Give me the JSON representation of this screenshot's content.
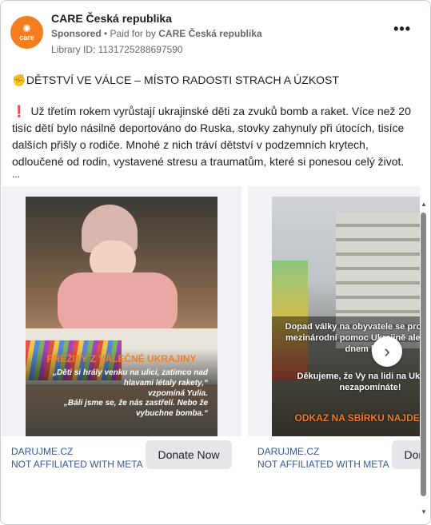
{
  "ad": {
    "page_name": "CARE Česká republika",
    "sponsored": "Sponsored",
    "paid_for_prefix": "• Paid for by",
    "paid_for_by": "CARE Česká republika",
    "library_id": "Library ID: 1131725288697590",
    "logo_text": "care",
    "more_menu": "•••"
  },
  "post": {
    "headline_emoji": "✊",
    "headline": "DĚTSTVÍ VE VÁLCE – MÍSTO RADOSTI STRACH A ÚZKOST",
    "body_mark": "❗",
    "body": "Už třetím rokem vyrůstají ukrajinské děti za zvuků bomb a raket. Více než 20 tisíc dětí bylo násilně deportováno do Ruska, stovky zahynuly při útocích, tisíce dalších přišly o rodiče. Mnohé z nich tráví dětství v podzemních krytech, odloučené od rodin, vystavené stresu a traumatům, které si ponesou celý život.",
    "more": "..."
  },
  "carousel": {
    "cards": [
      {
        "image_title": "PŘEŽITÝ Z VÁLEČNÉ UKRAJINY",
        "image_quote_1": "„Děti si hrály venku na ulici, zatímco nad hlavami létaly rakety,“",
        "image_quote_2": "vzpomíná Yulia.",
        "image_quote_3": "„Báli jsme se, že nás zastřelí. Nebo že vybuchne bomba.“",
        "site": "DARUJME.CZ",
        "disclaimer": "NOT AFFILIATED WITH META",
        "cta": "Donate Now"
      },
      {
        "image_text_1": "Dopad války na obyvatele se prohlubuje. mezinárodní pomoc Ukrajině ale každým dnem klesá.",
        "image_text_2": "Děkujeme, že Vy na lidi na Ukrajině nezapomínáte!",
        "image_cta": "ODKAZ NA SBÍRKU NAJDETE V",
        "site": "DARUJME.CZ",
        "disclaimer": "NOT AFFILIATED WITH META",
        "cta": "Donate Now"
      }
    ],
    "next_icon": "›"
  },
  "colors": {
    "brand_orange": "#f47d20",
    "link_blue": "#385898"
  }
}
